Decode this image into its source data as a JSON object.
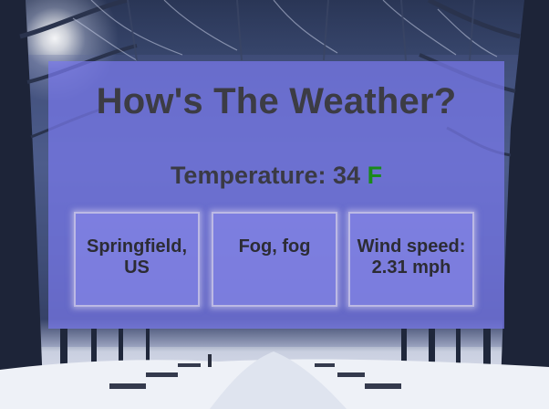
{
  "page": {
    "title": "How's The Weather?"
  },
  "temperature": {
    "label": "Temperature:",
    "value": "34",
    "unit": "F",
    "unit_color": "#1a8a1a"
  },
  "tiles": [
    {
      "text": "Springfield, US"
    },
    {
      "text": "Fog, fog"
    },
    {
      "text": "Wind speed: 2.31 mph"
    }
  ],
  "colors": {
    "card_background": "#7878eb",
    "title_text": "#3c3c44"
  }
}
